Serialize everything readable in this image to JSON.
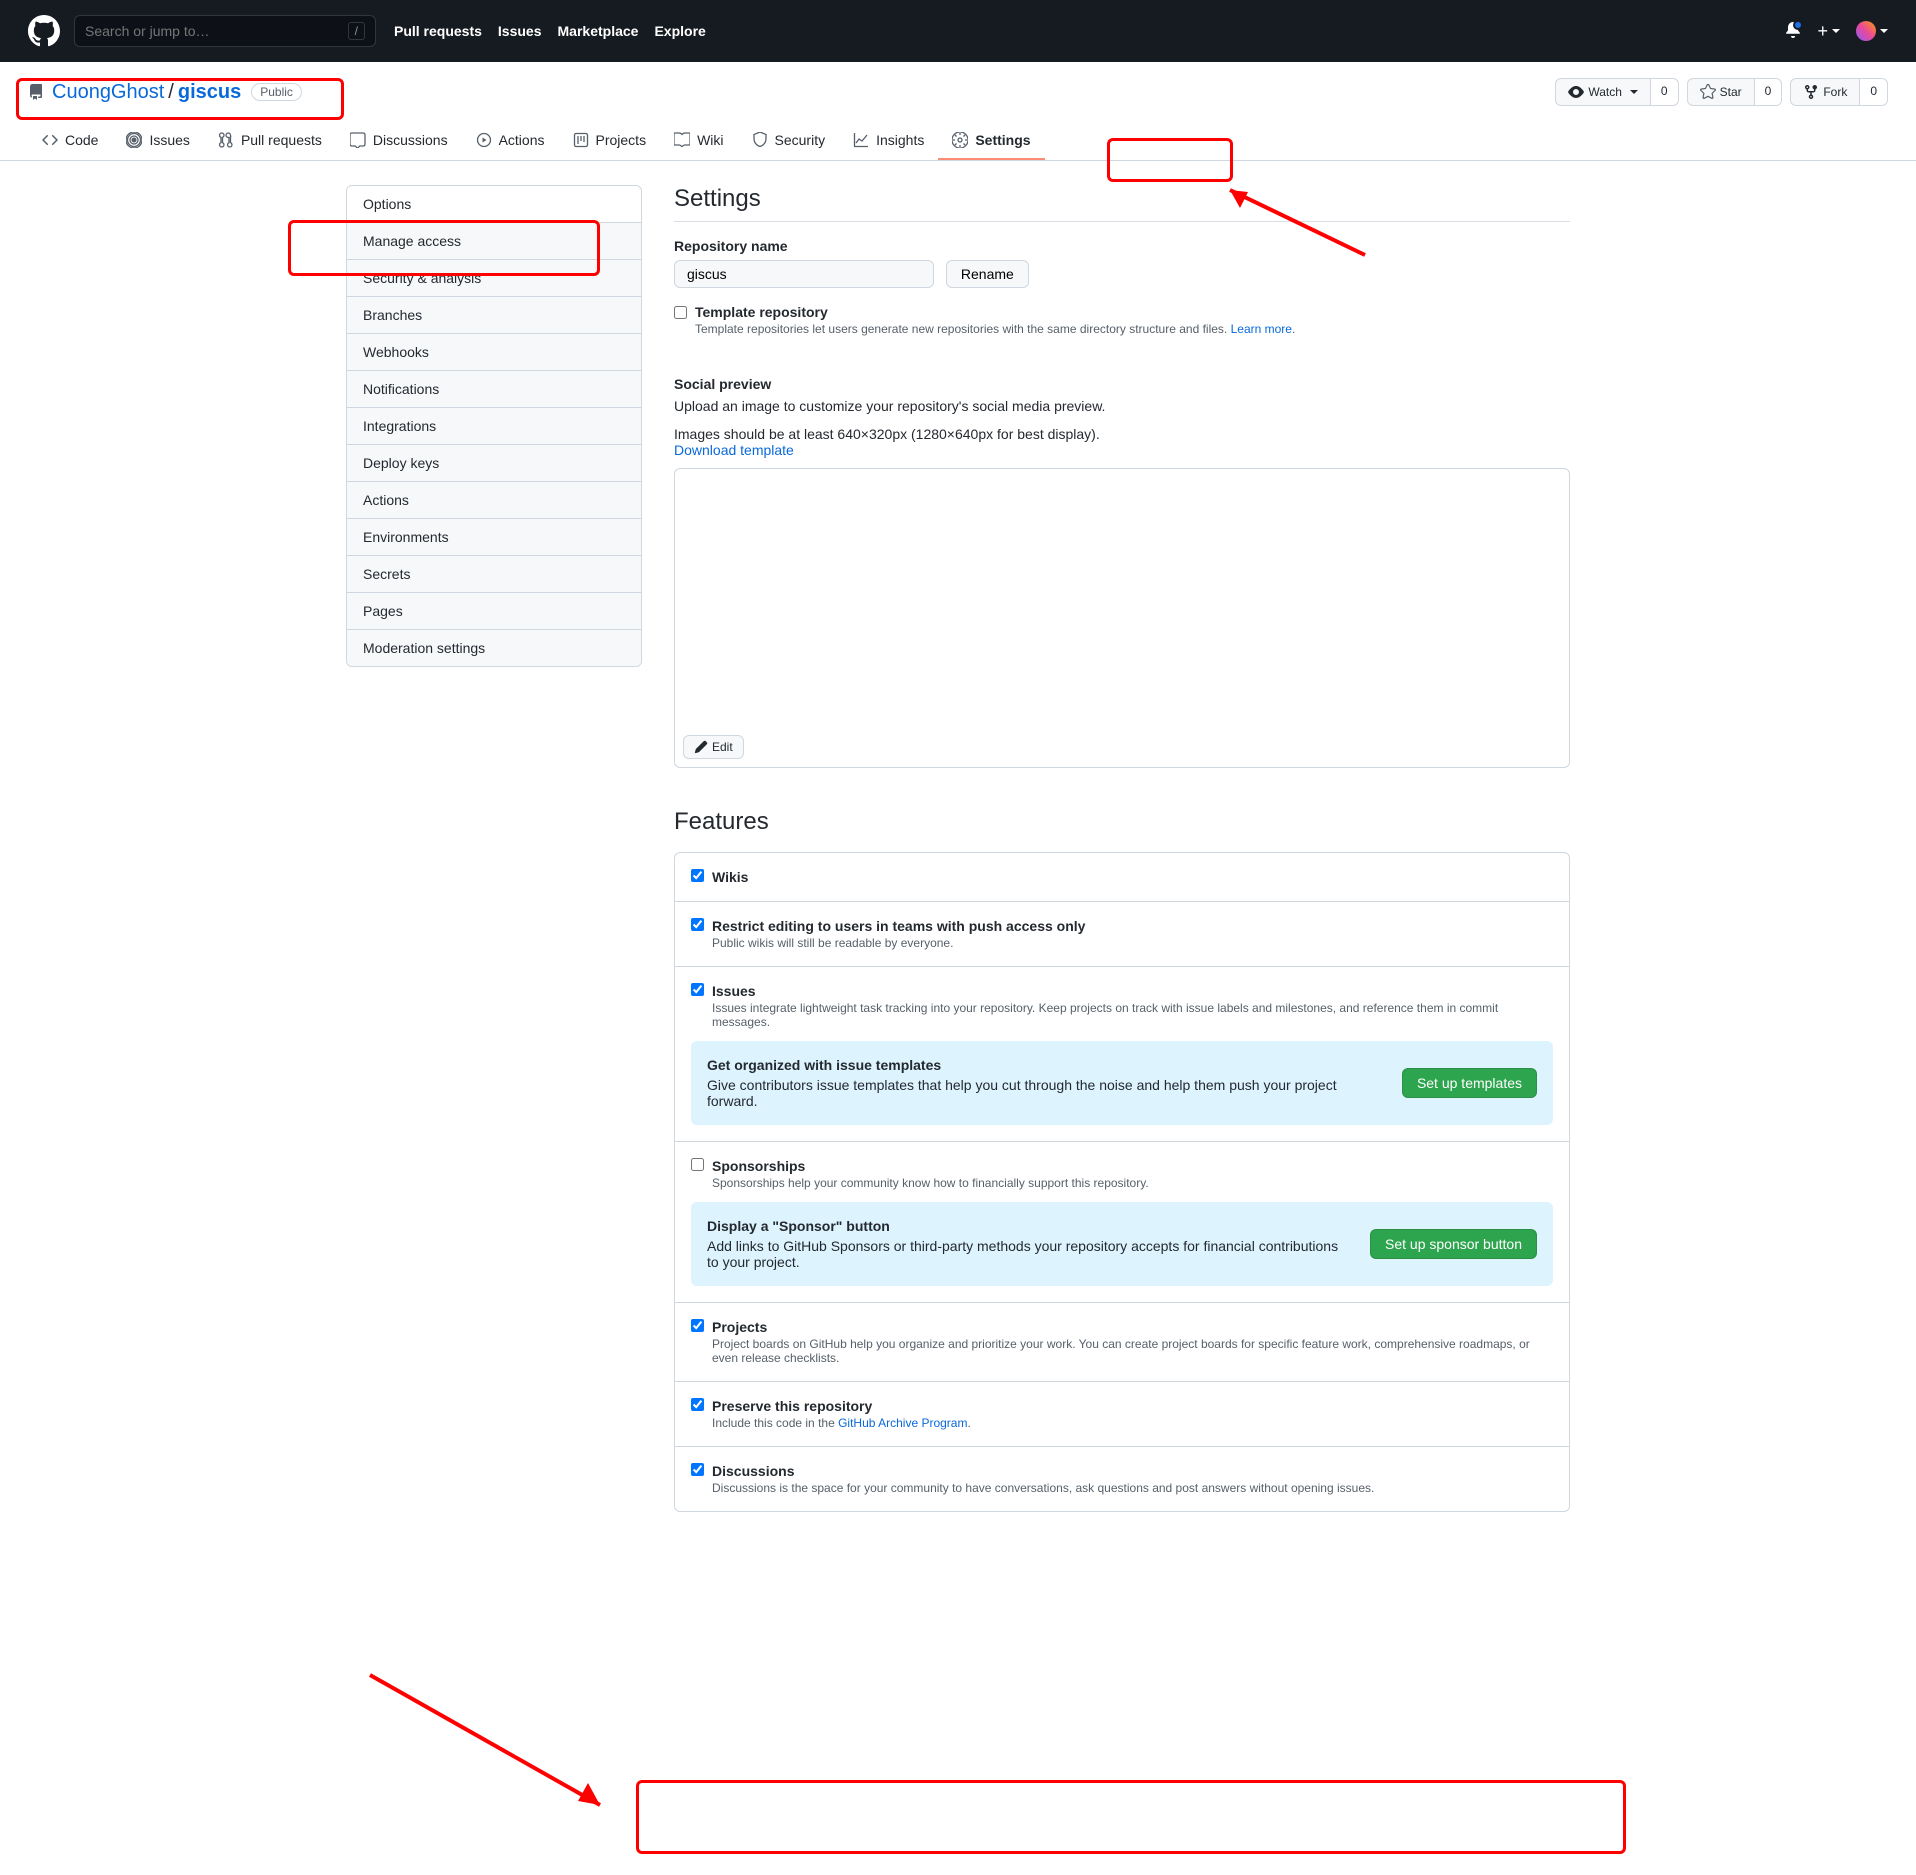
{
  "topbar": {
    "search_placeholder": "Search or jump to…",
    "links": [
      "Pull requests",
      "Issues",
      "Marketplace",
      "Explore"
    ]
  },
  "repo": {
    "owner": "CuongGhost",
    "name": "giscus",
    "visibility": "Public",
    "watch_label": "Watch",
    "watch_count": "0",
    "star_label": "Star",
    "star_count": "0",
    "fork_label": "Fork",
    "fork_count": "0"
  },
  "tabs": {
    "code": "Code",
    "issues": "Issues",
    "pull_requests": "Pull requests",
    "discussions": "Discussions",
    "actions": "Actions",
    "projects": "Projects",
    "wiki": "Wiki",
    "security": "Security",
    "insights": "Insights",
    "settings": "Settings"
  },
  "sidebar": {
    "items": [
      "Options",
      "Manage access",
      "Security & analysis",
      "Branches",
      "Webhooks",
      "Notifications",
      "Integrations",
      "Deploy keys",
      "Actions",
      "Environments",
      "Secrets",
      "Pages",
      "Moderation settings"
    ]
  },
  "settings": {
    "title": "Settings",
    "repo_name_label": "Repository name",
    "repo_name_value": "giscus",
    "rename_btn": "Rename",
    "template_label": "Template repository",
    "template_note_pre": "Template repositories let users generate new repositories with the same directory structure and files. ",
    "template_learn_more": "Learn more",
    "social_title": "Social preview",
    "social_desc": "Upload an image to customize your repository's social media preview.",
    "social_size": "Images should be at least 640×320px (1280×640px for best display).",
    "download_template": "Download template",
    "edit_btn": "Edit"
  },
  "features": {
    "title": "Features",
    "wikis": {
      "label": "Wikis"
    },
    "restrict": {
      "label": "Restrict editing to users in teams with push access only",
      "note": "Public wikis will still be readable by everyone."
    },
    "issues": {
      "label": "Issues",
      "note": "Issues integrate lightweight task tracking into your repository. Keep projects on track with issue labels and milestones, and reference them in commit messages."
    },
    "issues_callout": {
      "title": "Get organized with issue templates",
      "desc": "Give contributors issue templates that help you cut through the noise and help them push your project forward.",
      "btn": "Set up templates"
    },
    "sponsorships": {
      "label": "Sponsorships",
      "note": "Sponsorships help your community know how to financially support this repository."
    },
    "sponsor_callout": {
      "title": "Display a \"Sponsor\" button",
      "desc": "Add links to GitHub Sponsors or third-party methods your repository accepts for financial contributions to your project.",
      "btn": "Set up sponsor button"
    },
    "projects": {
      "label": "Projects",
      "note": "Project boards on GitHub help you organize and prioritize your work. You can create project boards for specific feature work, comprehensive roadmaps, or even release checklists."
    },
    "preserve": {
      "label": "Preserve this repository",
      "note_pre": "Include this code in the ",
      "link": "GitHub Archive Program",
      "note_post": "."
    },
    "discussions": {
      "label": "Discussions",
      "note": "Discussions is the space for your community to have conversations, ask questions and post answers without opening issues."
    }
  }
}
